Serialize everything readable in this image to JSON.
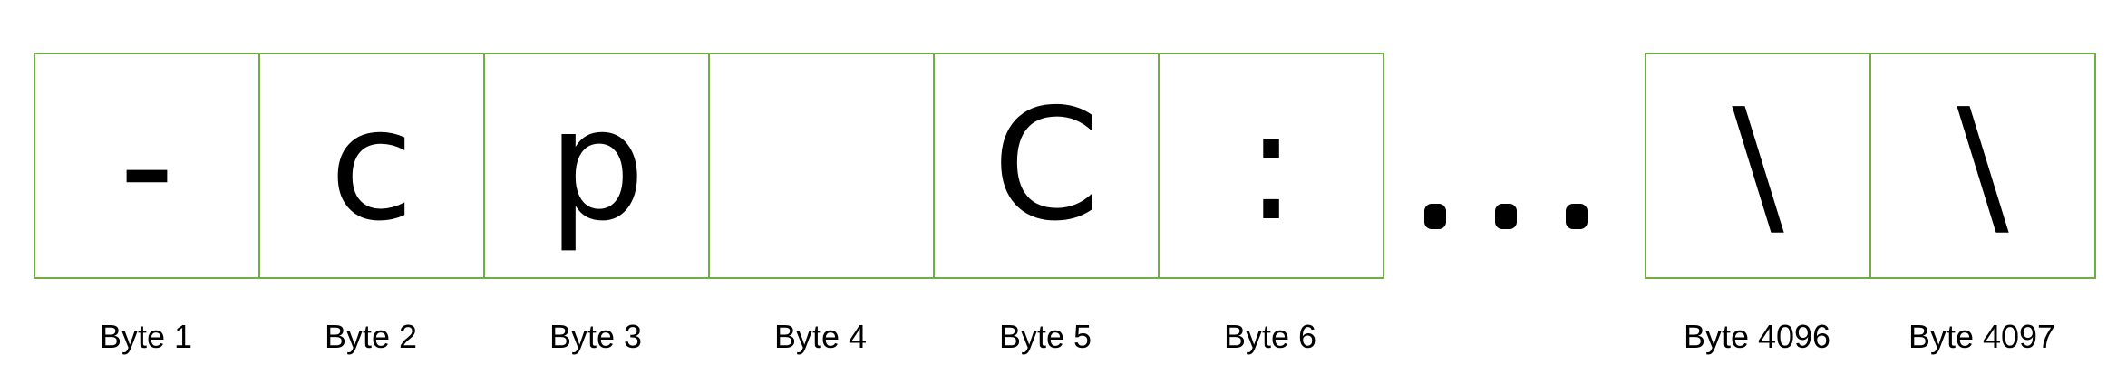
{
  "diagram": {
    "border_color": "#70ad47",
    "cells": [
      {
        "char": "-",
        "label": "Byte 1"
      },
      {
        "char": "c",
        "label": "Byte 2"
      },
      {
        "char": "p",
        "label": "Byte 3"
      },
      {
        "char": "",
        "label": "Byte 4"
      },
      {
        "char": "C",
        "label": "Byte 5"
      },
      {
        "char": ":",
        "label": "Byte 6"
      },
      {
        "char": "\\",
        "label": "Byte 4096"
      },
      {
        "char": "\\",
        "label": "Byte 4097"
      }
    ],
    "ellipsis_text": "..."
  }
}
